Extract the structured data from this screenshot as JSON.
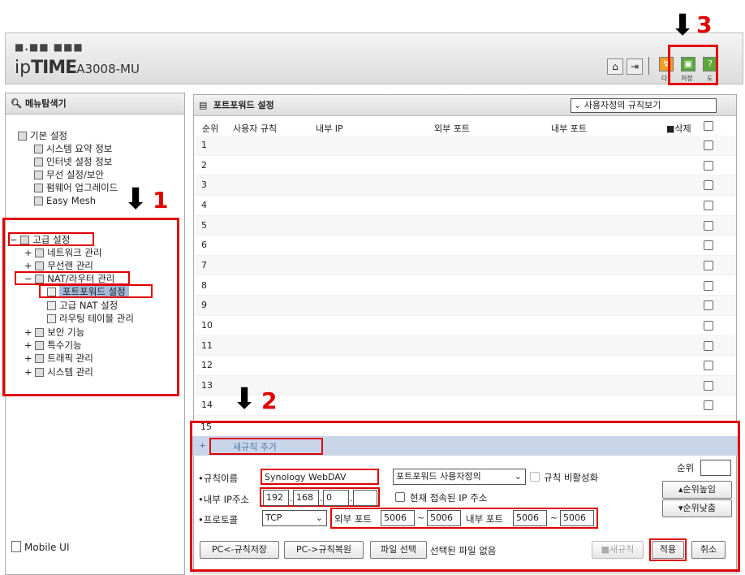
{
  "header": {
    "dots": "■.■■ ■■■",
    "brand_ip": "ip",
    "brand_time": "TIME",
    "model": "A3008-MU",
    "save_label": "저장",
    "da_label": "다",
    "do_label": "도"
  },
  "annotations": {
    "n1": "1",
    "n2": "2",
    "n3": "3"
  },
  "sidebar": {
    "title": "메뉴탐색기",
    "basic": "기본 설정",
    "basic_items": [
      "시스템 요약 정보",
      "인터넷 설정 정보",
      "무선 설정/보안",
      "펌웨어 업그레이드",
      "Easy Mesh"
    ],
    "advanced": "고급 설정",
    "adv_items": [
      "네트워크 관리",
      "무선랜 관리",
      "NAT/라우터 관리"
    ],
    "nat_items": [
      "포트포워드 설정",
      "고급 NAT 설정",
      "라우팅 테이블 관리"
    ],
    "adv_items2": [
      "보안 기능",
      "특수기능",
      "트래픽 관리",
      "시스템 관리"
    ],
    "mobile": "Mobile UI",
    "minus": "−",
    "plus": "+"
  },
  "main": {
    "title": "포트포워드 설정",
    "view_select": "사용자정의 규칙보기",
    "columns": {
      "order": "순위",
      "user_rule": "사용자 규칙",
      "internal_ip": "내부 IP",
      "external_port": "외부 포트",
      "internal_port": "내부 포트",
      "delete": "삭제"
    },
    "rows": [
      "1",
      "2",
      "3",
      "4",
      "5",
      "6",
      "7",
      "8",
      "9",
      "10",
      "11",
      "12",
      "13",
      "14",
      "15"
    ]
  },
  "form": {
    "add_rule": "새규칙 추가",
    "add_plus": "+",
    "rule_name_label": "규칙이름",
    "rule_name": "Synology WebDAV",
    "rule_type": "포트포워드 사용자정의",
    "disable_label": "규칙 비활성화",
    "order_label": "순위",
    "internal_ip_label": "내부 IP주소",
    "ip": [
      "192",
      "168",
      "0",
      ""
    ],
    "current_ip_label": "현재 접속된 IP 주소",
    "protocol_label": "프로토콜",
    "protocol": "TCP",
    "ext_port_label": "외부 포트",
    "ext_from": "5006",
    "ext_to": "5006",
    "int_port_label": "내부 포트",
    "int_from": "5006",
    "int_to": "5006",
    "tilde": "~",
    "dot": ".",
    "bullet": "•",
    "up_btn": "순위높임",
    "down_btn": "순위낮춤"
  },
  "buttons": {
    "pc_save": "PC<-규칙저장",
    "pc_restore": "PC->규칙복원",
    "file_select": "파일 선택",
    "no_file": "선택된 파일 없음",
    "new_rule": "새규칙",
    "apply": "적용",
    "cancel": "취소"
  }
}
